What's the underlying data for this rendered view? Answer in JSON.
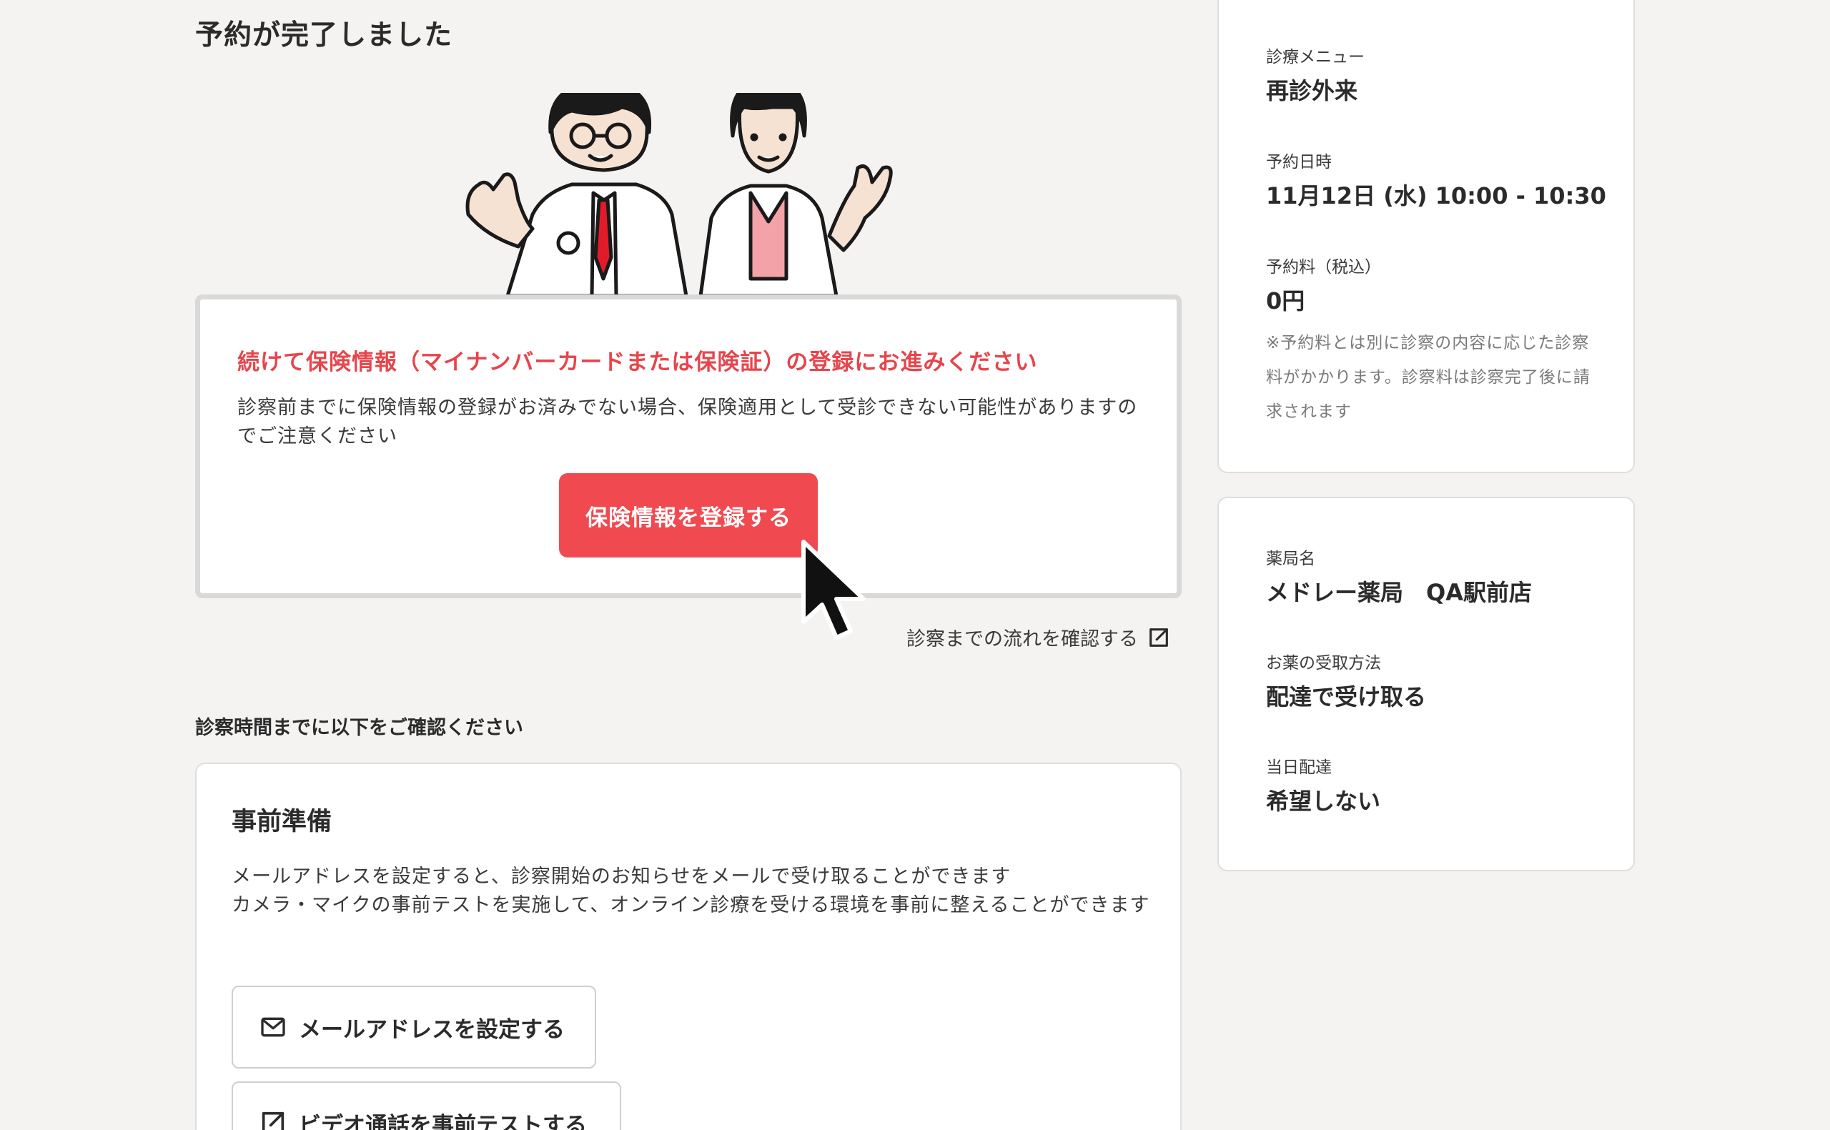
{
  "page_title": "予約が完了しました",
  "insurance": {
    "heading": "続けて保険情報（マイナンバーカードまたは保険証）の登録にお進みください",
    "body": "診察前までに保険情報の登録がお済みでない場合、保険適用として受診できない可能性がありますのでご注意ください",
    "button_label": "保険情報を登録する"
  },
  "flow_link": {
    "label": "診察までの流れを確認する",
    "icon": "external-link-icon"
  },
  "section_label": "診察時間までに以下をご確認ください",
  "prep": {
    "title": "事前準備",
    "line1": "メールアドレスを設定すると、診察開始のお知らせをメールで受け取ることができます",
    "line2": "カメラ・マイクの事前テストを実施して、オンライン診療を受ける環境を事前に整えることができます",
    "email_button": {
      "label": "メールアドレスを設定する",
      "icon": "mail-icon"
    },
    "video_button": {
      "label": "ビデオ通話を事前テストする",
      "icon": "external-link-icon"
    }
  },
  "reservation": {
    "menu_label": "診療メニュー",
    "menu_value": "再診外来",
    "datetime_label": "予約日時",
    "datetime_value": "11月12日 (水) 10:00 - 10:30",
    "fee_label": "予約料（税込）",
    "fee_value": "0円",
    "note": "※予約料とは別に診察の内容に応じた診察料がかかります。診察料は診察完了後に請求されます"
  },
  "pharmacy": {
    "name_label": "薬局名",
    "name_value": "メドレー薬局　QA駅前店",
    "receive_label": "お薬の受取方法",
    "receive_value": "配達で受け取る",
    "sameday_label": "当日配達",
    "sameday_value": "希望しない"
  },
  "colors": {
    "accent": "#f04a50",
    "accent_text": "#e8444b",
    "background": "#f4f3f1"
  }
}
